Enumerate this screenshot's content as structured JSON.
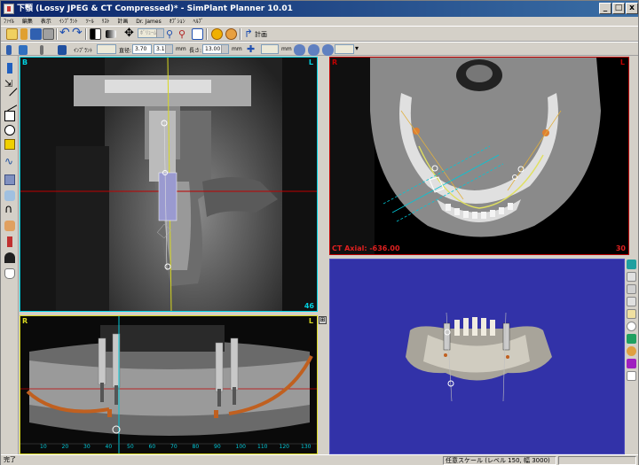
{
  "window": {
    "title": "下顎 (Lossy JPEG & CT Compressed)* - SimPlant Planner  10.01",
    "min": "_",
    "max": "□",
    "close": "x"
  },
  "menu": [
    "ﾌｧｲﾙ",
    "編集",
    "表示",
    "ｲﾝﾌﾟﾗﾝﾄ",
    "ﾂｰﾙ",
    "ﾘｽﾄ",
    "計画",
    "Dr. James",
    "ｵﾌﾟｼｮﾝ",
    "ﾍﾙﾌﾟ"
  ],
  "toolbar": {
    "mode_value": "ﾎﾞﾘｭｰﾑ",
    "plan_label": "計画"
  },
  "implant_bar": {
    "implant_label": "ｲﾝﾌﾟﾗﾝﾄ",
    "diameter_label": "直径:",
    "diameter_value": "3.70",
    "diameter_select": "3.10",
    "unit1": "mm",
    "length_label": "長さ:",
    "length_value": "13.00",
    "unit2": "mm",
    "unit3": "mm"
  },
  "views": {
    "tl": {
      "corner_left": "B",
      "corner_right": "L",
      "slice": "46"
    },
    "tr": {
      "corner_left": "R",
      "corner_right": "L",
      "caption": "CT Axial: -636.00",
      "slice": "30"
    },
    "bl": {
      "corner_left": "R",
      "corner_right": "L",
      "ruler": [
        "10",
        "20",
        "30",
        "40",
        "50",
        "60",
        "70",
        "80",
        "90",
        "100",
        "110",
        "120",
        "130"
      ]
    },
    "br": {}
  },
  "status": {
    "left": "完了",
    "cell2": "任意スケール (レベル 150, 幅 3000)"
  },
  "colors": {
    "accent_red": "#c00000",
    "accent_cyan": "#00d0e0",
    "accent_yellow": "#d8d820",
    "view3d_bg": "#3232a8",
    "implant_orange": "#c06020"
  },
  "icons": [
    "new-icon",
    "open-icon",
    "save-icon",
    "print-icon",
    "undo-icon",
    "redo-icon",
    "contrast-icon",
    "grayscale-icon",
    "move-icon",
    "zoom-icon",
    "zoom-in-icon",
    "window-icon",
    "info-icon",
    "settings-icon",
    "plan-icon"
  ]
}
